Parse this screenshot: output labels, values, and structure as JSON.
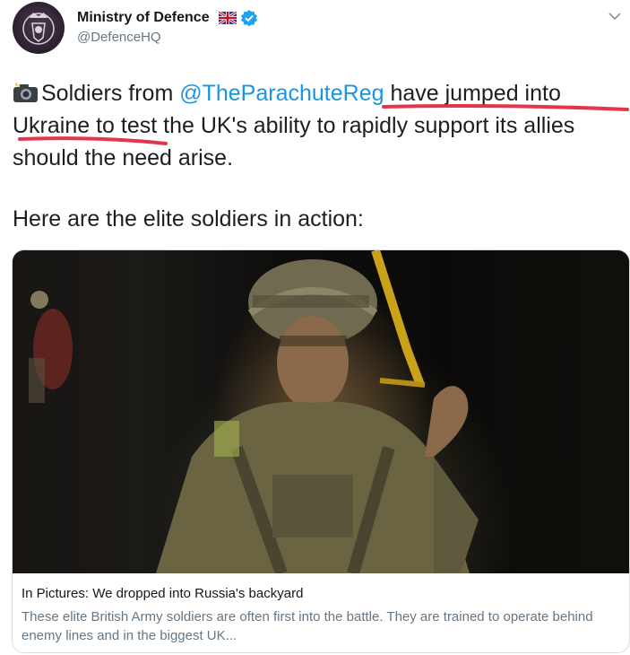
{
  "author": {
    "display_name": "Ministry of Defence",
    "handle": "@DefenceHQ",
    "flag_icon": "union-jack-flag-icon",
    "verified_icon": "verified-badge-icon",
    "avatar_icon": "crest-logo-icon"
  },
  "tweet": {
    "emoji_icon": "camera-flash-emoji-icon",
    "text_before_mention": "Soldiers from ",
    "mention": "@TheParachuteReg",
    "text_after_mention": " have jumped into Ukraine to test the UK's ability to rapidly support its allies should the need arise.",
    "second_paragraph": "Here are the elite soldiers in action:"
  },
  "card": {
    "title": "In Pictures: We dropped into Russia's backyard",
    "description": "These elite British Army soldiers are often first into the battle. They are trained to operate behind enemy lines and in the biggest UK..."
  },
  "colors": {
    "mention": "#1b95e0",
    "verified": "#1da1f2",
    "underline_annotation": "#e0203a"
  },
  "menu": {
    "chevron_icon": "chevron-down-icon"
  }
}
